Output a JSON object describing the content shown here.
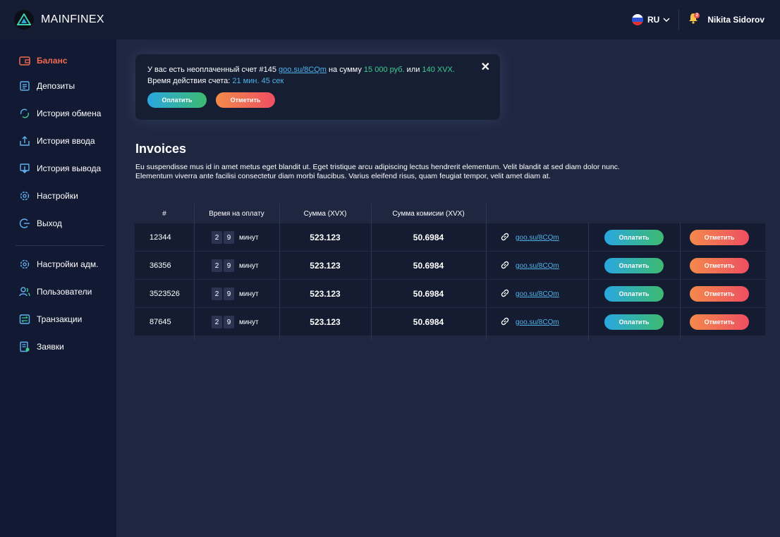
{
  "app": {
    "name": "MAINFINEX"
  },
  "header": {
    "language": "RU",
    "notification_count": "2",
    "user_name": "Nikita Sidorov"
  },
  "sidebar": {
    "items": [
      {
        "label": "Баланс",
        "icon": "wallet-icon",
        "active": true
      },
      {
        "label": "Депозиты",
        "icon": "deposit-icon"
      },
      {
        "label": "История обмена",
        "icon": "exchange-icon"
      },
      {
        "label": "История ввода",
        "icon": "upload-icon"
      },
      {
        "label": "История вывода",
        "icon": "download-icon"
      },
      {
        "label": "Настройки",
        "icon": "gear-icon"
      },
      {
        "label": "Выход",
        "icon": "logout-icon"
      }
    ],
    "admin_items": [
      {
        "label": "Настройки адм.",
        "icon": "gear-icon"
      },
      {
        "label": "Пользователи",
        "icon": "users-icon"
      },
      {
        "label": "Транзакции",
        "icon": "transactions-icon"
      },
      {
        "label": "Заявки",
        "icon": "requests-icon"
      }
    ]
  },
  "alert": {
    "text_prefix": "У вас есть неоплаченный счет #145",
    "link": "goo.su/8CQm",
    "text_mid": "на сумму",
    "amount_rub": "15 000 руб.",
    "text_or": "или",
    "amount_xvx": "140 XVX.",
    "timer_label": "Время действия счета:",
    "timer_value": "21 мин. 45 сек",
    "pay_label": "Оплатить",
    "cancel_label": "Отметить",
    "close": "✕"
  },
  "main": {
    "title": "Invoices",
    "description": "Eu suspendisse mus id in amet metus eget blandit ut. Eget tristique arcu adipiscing lectus hendrerit elementum. Velit blandit at sed diam dolor nunc. Elementum viverra ante facilisi consectetur diam morbi faucibus. Varius eleifend risus, quam feugiat tempor, velit amet diam at."
  },
  "table": {
    "columns": [
      "#",
      "Время на оплату",
      "Сумма (XVX)",
      "Сумма комисии (XVX)"
    ],
    "rows": [
      {
        "id": "12344",
        "d1": "2",
        "d2": "9",
        "unit": "минут",
        "sum": "523.123",
        "fee": "50.6984",
        "link": "goo.su/8CQm",
        "pay": "Оплатить",
        "cancel": "Отметить"
      },
      {
        "id": "36356",
        "d1": "2",
        "d2": "9",
        "unit": "минут",
        "sum": "523.123",
        "fee": "50.6984",
        "link": "goo.su/8CQm",
        "pay": "Оплатить",
        "cancel": "Отметить"
      },
      {
        "id": "3523526",
        "d1": "2",
        "d2": "9",
        "unit": "минут",
        "sum": "523.123",
        "fee": "50.6984",
        "link": "goo.su/8CQm",
        "pay": "Оплатить",
        "cancel": "Отметить"
      },
      {
        "id": "87645",
        "d1": "2",
        "d2": "9",
        "unit": "минут",
        "sum": "523.123",
        "fee": "50.6984",
        "link": "goo.su/8CQm",
        "pay": "Оплатить",
        "cancel": "Отметить"
      }
    ]
  },
  "colors": {
    "accent_active": "#ef6a4f",
    "link": "#4fb3e8",
    "green": "#3ecf8e",
    "bg": "#1f2740",
    "sidebar": "#121a33"
  }
}
